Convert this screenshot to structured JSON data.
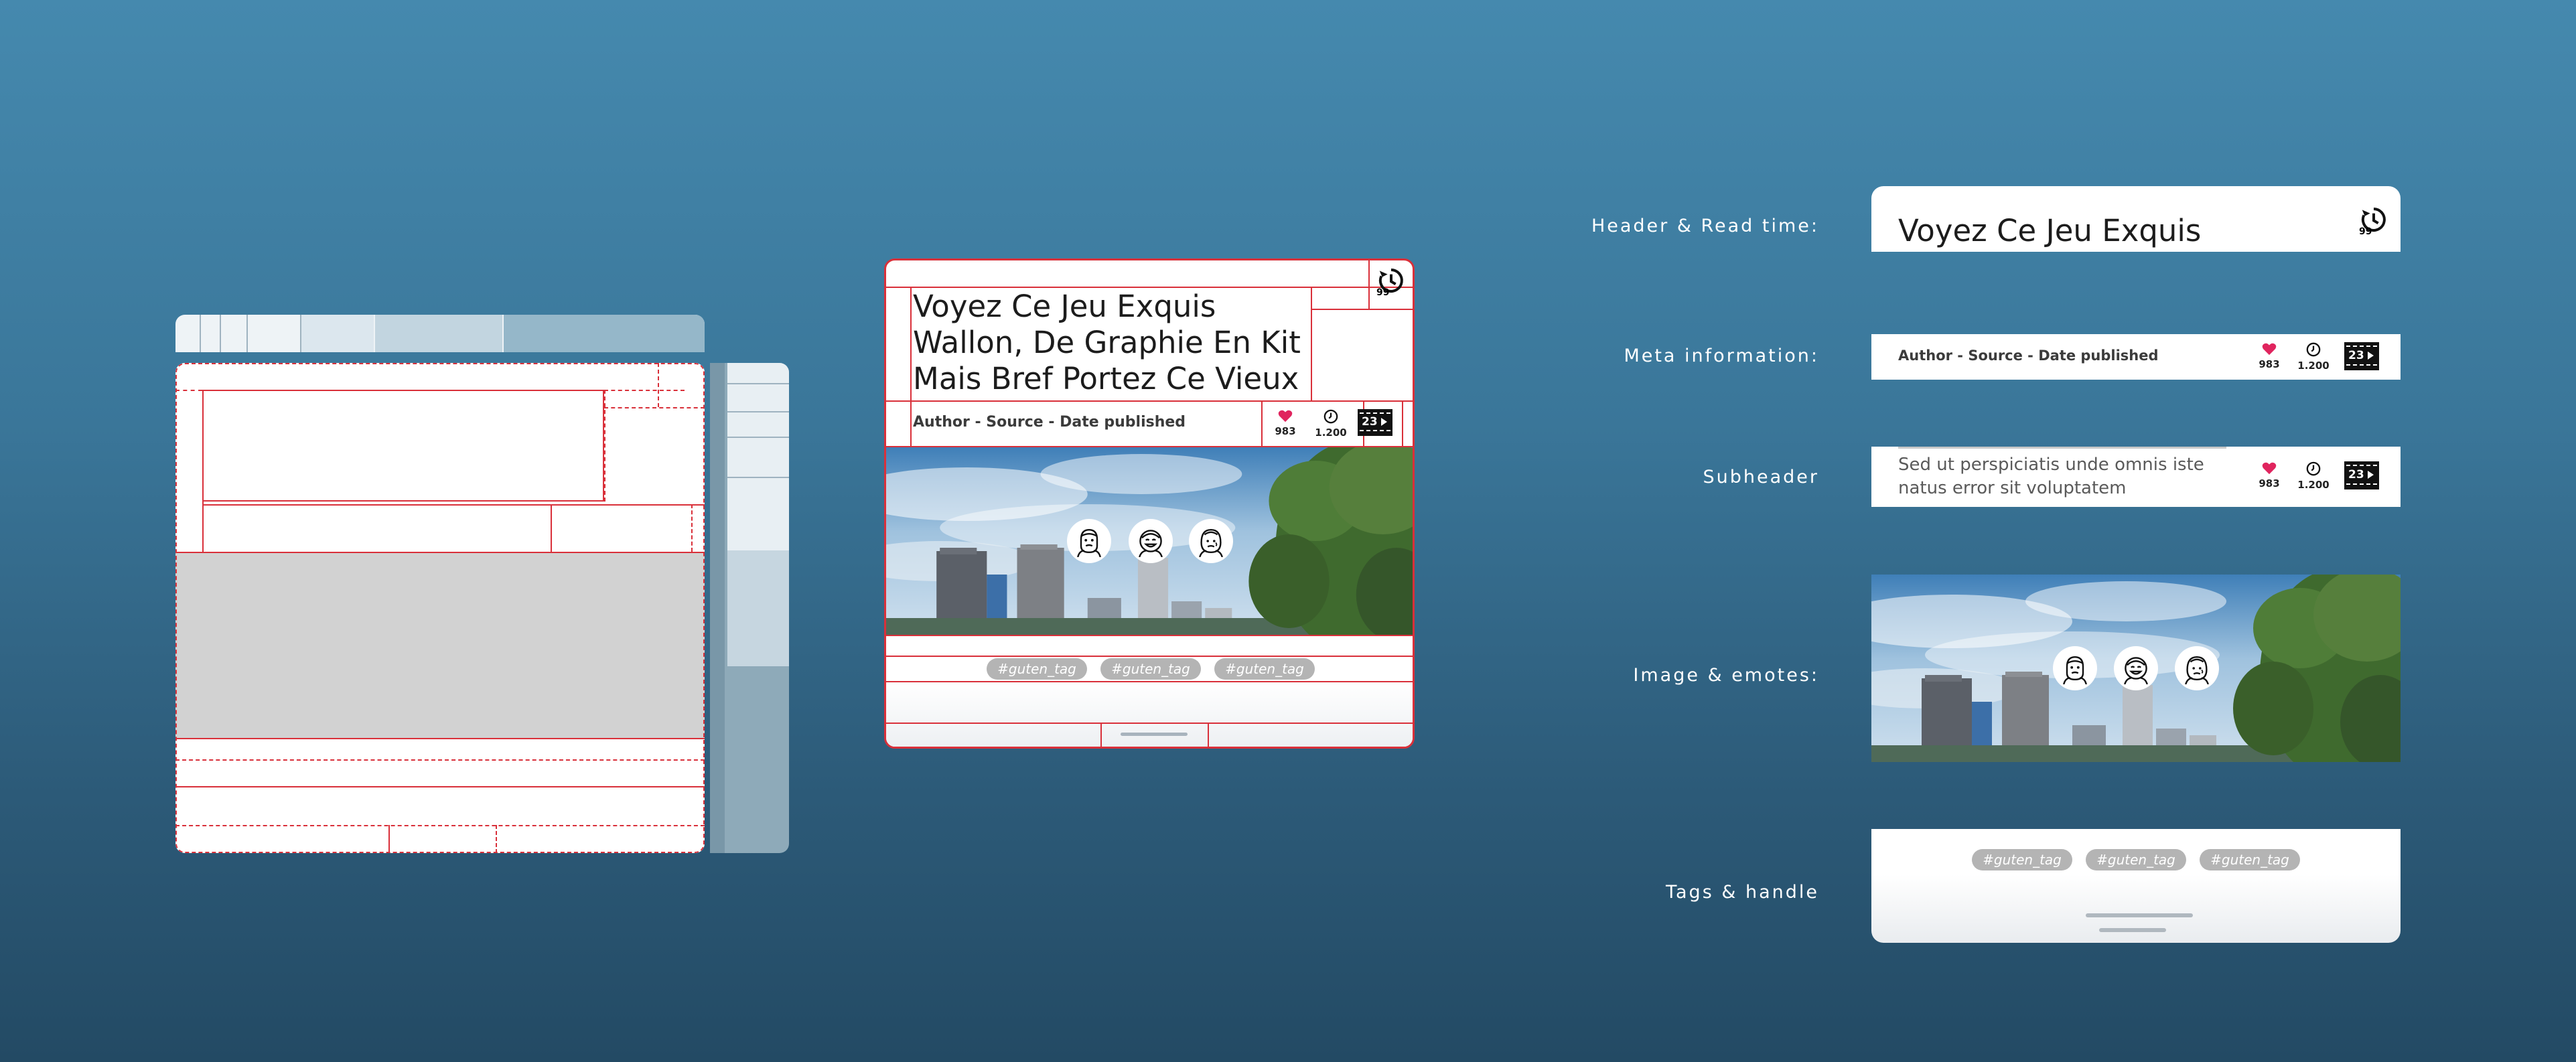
{
  "sections": {
    "header_read_time": "Header & Read time:",
    "meta_information": "Meta information:",
    "subheader": "Subheader",
    "image_emotes": "Image & emotes:",
    "tags_handle": "Tags & handle"
  },
  "article": {
    "title_line1": "Voyez Ce Jeu Exquis",
    "title_line2": "Wallon, De Graphie En Kit",
    "title_line3": "Mais Bref Portez Ce Vieux",
    "short_title": "Voyez Ce Jeu Exquis",
    "meta": "Author - Source - Date published",
    "subheader_line1": "Sed ut perspiciatis unde omnis iste",
    "subheader_line2": "natus error sit voluptatem",
    "read_time": "99",
    "likes": "983",
    "views": "1.200",
    "comments": "23",
    "tags": [
      "#guten_tag",
      "#guten_tag",
      "#guten_tag"
    ]
  },
  "colors": {
    "accent_red": "#d9303a",
    "heart": "#e0245e",
    "background_top": "#4589ae",
    "background_bottom": "#234a64"
  },
  "icons": [
    "read-time-icon",
    "heart-icon",
    "clock-icon",
    "comment-video-icon",
    "emote-neutral-icon",
    "emote-happy-icon",
    "emote-worried-icon"
  ]
}
